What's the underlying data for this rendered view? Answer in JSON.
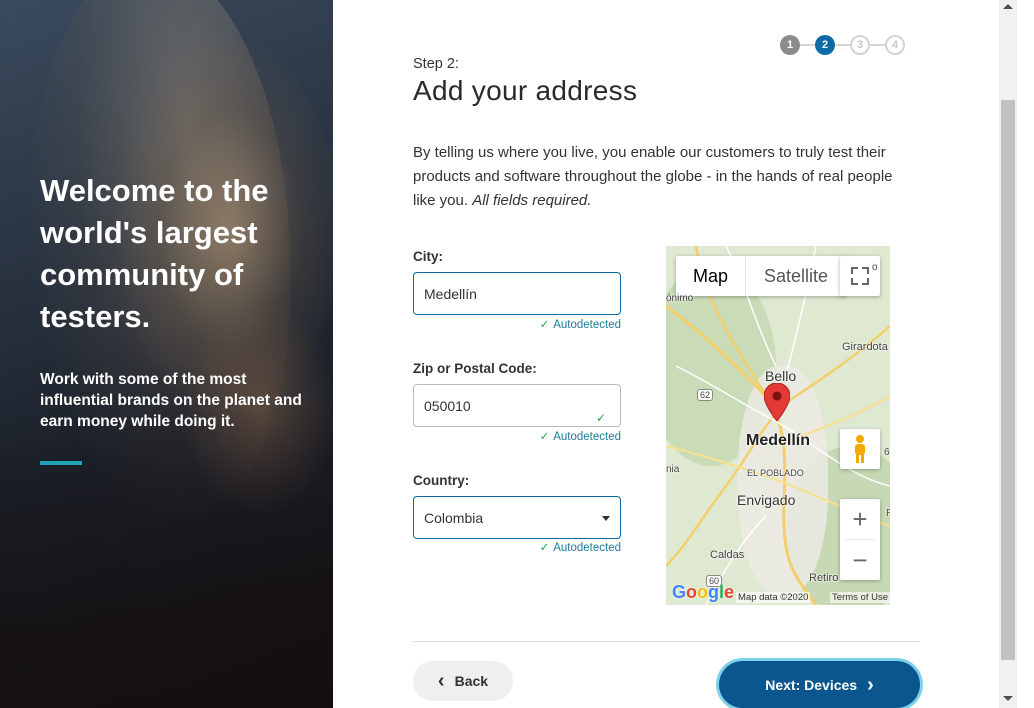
{
  "hero": {
    "title": "Welcome to the world's largest community of testers.",
    "subtitle": "Work with some of the most influential brands on the planet and earn money while doing it.",
    "accent_color": "#1fa3b3"
  },
  "stepper": {
    "steps": [
      "1",
      "2",
      "3",
      "4"
    ],
    "current": 2,
    "active_color": "#0c6ba5"
  },
  "header": {
    "step_label": "Step 2:",
    "title": "Add your address"
  },
  "intro": {
    "text": "By telling us where you live, you enable our customers to truly test their products and software throughout the globe - in the hands of real people like you.",
    "required_note": "All fields required."
  },
  "form": {
    "city": {
      "label": "City:",
      "value": "Medellín",
      "status": "Autodetected"
    },
    "zip": {
      "label": "Zip or Postal Code:",
      "value": "050010",
      "status": "Autodetected"
    },
    "country": {
      "label": "Country:",
      "value": "Colombia",
      "status": "Autodetected"
    }
  },
  "map": {
    "tabs": {
      "map": "Map",
      "satellite": "Satellite"
    },
    "labels": {
      "bello": "Bello",
      "medellin": "Medellín",
      "el_poblado": "EL POBLADO",
      "envigado": "Envigado",
      "girardota": "Girardota",
      "caldas": "Caldas",
      "retiro": "Retiro",
      "onimo": "ónimo",
      "nia": "nia",
      "road_62": "62",
      "road_60": "60",
      "edge_o": "o",
      "edge_6": "6",
      "edge_r": "R"
    },
    "logo": "Google",
    "attribution": "Map data ©2020",
    "terms": "Terms of Use",
    "zoom_in": "+",
    "zoom_out": "−"
  },
  "buttons": {
    "back": "Back",
    "next": "Next: Devices"
  },
  "icons": {
    "check": "✓",
    "chevron_left": "‹",
    "chevron_right": "›"
  }
}
